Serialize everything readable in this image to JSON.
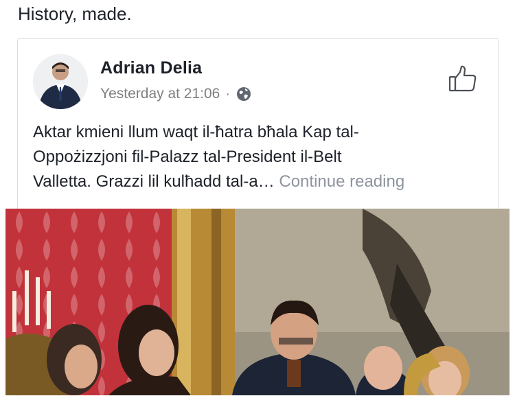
{
  "caption": "History, made.",
  "post": {
    "author": "Adrian Delia",
    "timestamp": "Yesterday at 21:06",
    "separator": "·",
    "text_line1": "Aktar kmieni llum waqt il-ħatra bħala Kap tal-",
    "text_line2": "Oppożizzjoni fil-Palazz tal-President il-Belt",
    "text_line3": "Valletta. Grazzi lil kulħadd tal-a…",
    "continue_label": "Continue reading"
  },
  "icons": {
    "like": "thumbs-up-icon",
    "privacy": "globe-icon",
    "avatar": "profile-photo"
  },
  "colors": {
    "text": "#1d2129",
    "muted": "#7f7f7f",
    "border": "#d9dbe0",
    "link_muted": "#8d949e"
  }
}
